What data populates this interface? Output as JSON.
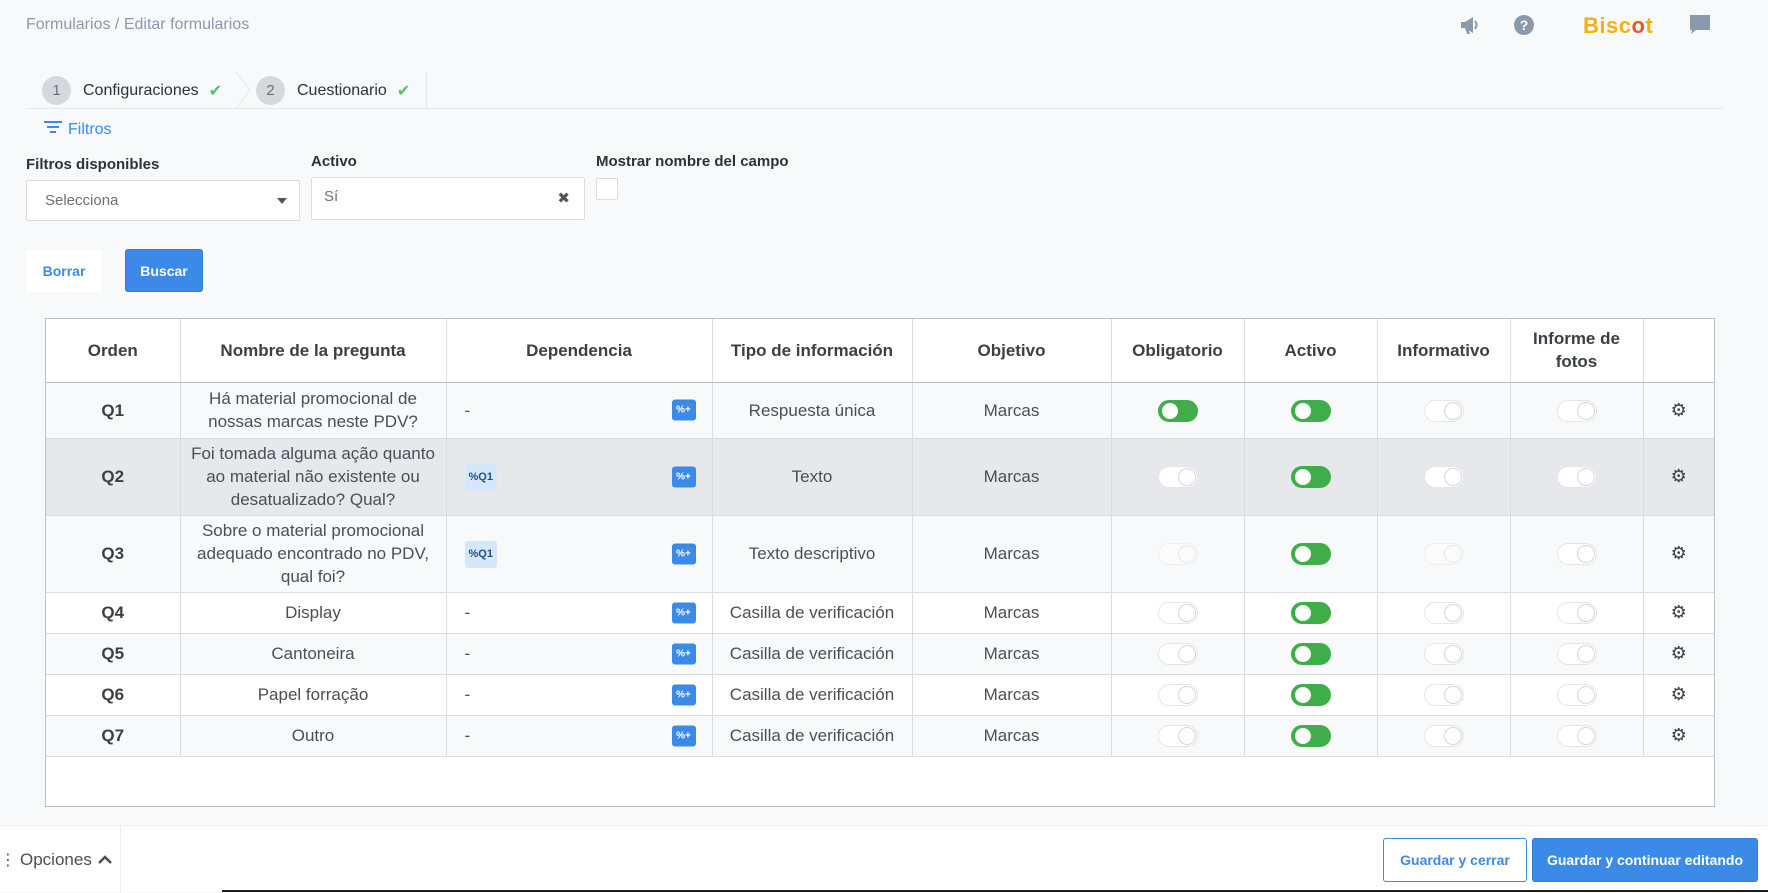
{
  "breadcrumb": {
    "root": "Formularios",
    "separator": "/",
    "current": "Editar formularios"
  },
  "brand": {
    "name_main": "Bisc",
    "name_dot": "o",
    "name_end": "t",
    "color": "#f2b10f",
    "accent": "#e8572d"
  },
  "steps": [
    {
      "number": "1",
      "label": "Configuraciones",
      "done": true
    },
    {
      "number": "2",
      "label": "Cuestionario",
      "done": true
    }
  ],
  "filters": {
    "toggle_label": "Filtros",
    "available_label": "Filtros disponibles",
    "available_placeholder": "Selecciona",
    "activo_label": "Activo",
    "activo_value": "Sí",
    "show_name_label": "Mostrar nombre del campo",
    "clear_button": "Borrar",
    "search_button": "Buscar"
  },
  "table": {
    "columns": [
      "Orden",
      "Nombre de la pregunta",
      "Dependencia",
      "Tipo de información",
      "Objetivo",
      "Obligatorio",
      "Activo",
      "Informativo",
      "Informe de fotos",
      ""
    ],
    "rows": [
      {
        "order": "Q1",
        "name": "Há material promocional de nossas marcas neste PDV?",
        "dependency": "-",
        "dep_is_tag": false,
        "type": "Respuesta única",
        "objective": "Marcas",
        "obligatorio": "on",
        "activo": "on",
        "informativo": "off",
        "informe": "off"
      },
      {
        "order": "Q2",
        "name": "Foi tomada alguma ação quanto ao material não existente ou desatualizado? Qual?",
        "dependency": "Q1",
        "dep_is_tag": true,
        "type": "Texto",
        "objective": "Marcas",
        "obligatorio": "off",
        "activo": "on",
        "informativo": "off",
        "informe": "off"
      },
      {
        "order": "Q3",
        "name": "Sobre o material promocional adequado encontrado no PDV, qual foi?",
        "dependency": "Q1",
        "dep_is_tag": true,
        "type": "Texto descriptivo",
        "objective": "Marcas",
        "obligatorio": "disabled",
        "activo": "on",
        "informativo": "disabled",
        "informe": "off"
      },
      {
        "order": "Q4",
        "name": "Display",
        "dependency": "-",
        "dep_is_tag": false,
        "type": "Casilla de verificación",
        "objective": "Marcas",
        "obligatorio": "off",
        "activo": "on",
        "informativo": "off",
        "informe": "off"
      },
      {
        "order": "Q5",
        "name": "Cantoneira",
        "dependency": "-",
        "dep_is_tag": false,
        "type": "Casilla de verificación",
        "objective": "Marcas",
        "obligatorio": "off",
        "activo": "on",
        "informativo": "off",
        "informe": "off"
      },
      {
        "order": "Q6",
        "name": "Papel forração",
        "dependency": "-",
        "dep_is_tag": false,
        "type": "Casilla de verificación",
        "objective": "Marcas",
        "obligatorio": "off",
        "activo": "on",
        "informativo": "off",
        "informe": "off"
      },
      {
        "order": "Q7",
        "name": "Outro",
        "dependency": "-",
        "dep_is_tag": false,
        "type": "Casilla de verificación",
        "objective": "Marcas",
        "obligatorio": "off",
        "activo": "on",
        "informativo": "off",
        "informe": "off"
      }
    ]
  },
  "footer": {
    "options_label": "Opciones",
    "save_close": "Guardar y cerrar",
    "save_continue": "Guardar y continuar editando"
  },
  "colors": {
    "primary": "#3b8ae8",
    "toggle_on": "#3fae49",
    "check": "#53c364"
  }
}
